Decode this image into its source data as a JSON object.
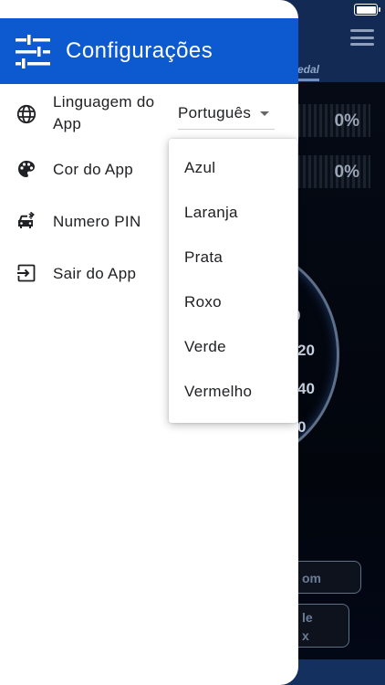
{
  "drawer": {
    "title": "Configurações",
    "items": [
      {
        "label_line1": "Linguagem do",
        "label_line2": "App",
        "icon": "globe-icon"
      },
      {
        "label": "Cor do App",
        "icon": "palette-icon"
      },
      {
        "label": "Numero PIN",
        "icon": "car-bluetooth-icon"
      },
      {
        "label": "Sair do App",
        "icon": "exit-icon"
      }
    ],
    "language_select": {
      "value": "Português"
    }
  },
  "color_dropdown": {
    "options": [
      "Azul",
      "Laranja",
      "Prata",
      "Roxo",
      "Verde",
      "Vermelho"
    ]
  },
  "background": {
    "tab_label": "edal",
    "percent_1": "0%",
    "percent_2": "0%",
    "gauge_numbers": [
      "0",
      "20",
      "40",
      "0"
    ],
    "button_1": "om",
    "button_2_line1": "le",
    "button_2_line2": "x"
  },
  "colors": {
    "header_blue": "#0c59d0",
    "drawer_bg": "#ffffff"
  }
}
